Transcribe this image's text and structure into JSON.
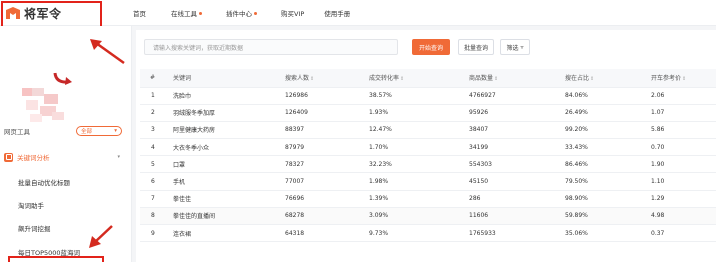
{
  "brand": {
    "name": "将军令"
  },
  "nav": [
    {
      "label": "首页",
      "dot": false,
      "caret": false
    },
    {
      "label": "在线工具",
      "dot": true,
      "caret": false
    },
    {
      "label": "插件中心",
      "dot": true,
      "caret": true
    },
    {
      "label": "购买VIP",
      "dot": false,
      "caret": false
    },
    {
      "label": "使用手册",
      "dot": false,
      "caret": false
    }
  ],
  "sidebar": {
    "tools_label": "网页工具",
    "filter_value": "全部",
    "section_label": "关键词分析",
    "sub_items": [
      "批量自动优化标题",
      "淘词助手",
      "飙升词挖掘",
      "每日TOP5000蓝海词"
    ]
  },
  "search": {
    "placeholder": "请输入搜索关键词，获取近期数据",
    "submit_label": "开始查询",
    "batch_label": "批量查询",
    "filter_label": "筛选"
  },
  "table": {
    "headers": [
      "#",
      "关键词",
      "搜索人数",
      "成交转化率",
      "商品数量",
      "搜在占比",
      "开车参考价"
    ],
    "sortable": [
      false,
      false,
      true,
      true,
      true,
      true,
      true
    ],
    "rows": [
      [
        "1",
        "洗脸巾",
        "126986",
        "38.57%",
        "4766927",
        "84.06%",
        "2.06"
      ],
      [
        "2",
        "羽绒服冬季加厚",
        "126409",
        "1.93%",
        "95926",
        "26.49%",
        "1.07"
      ],
      [
        "3",
        "阿里健康大药房",
        "88397",
        "12.47%",
        "38407",
        "99.20%",
        "5.86"
      ],
      [
        "4",
        "大衣冬季小众",
        "87979",
        "1.70%",
        "34199",
        "33.43%",
        "0.70"
      ],
      [
        "5",
        "口罩",
        "78327",
        "32.23%",
        "554303",
        "86.46%",
        "1.90"
      ],
      [
        "6",
        "手机",
        "77007",
        "1.98%",
        "45150",
        "79.50%",
        "1.10"
      ],
      [
        "7",
        "拳佳佳",
        "76696",
        "1.39%",
        "286",
        "98.90%",
        "1.29"
      ],
      [
        "8",
        "拳佳佳的直播间",
        "68278",
        "3.09%",
        "11606",
        "59.89%",
        "4.98"
      ],
      [
        "9",
        "连衣裙",
        "64318",
        "9.73%",
        "1765933",
        "35.06%",
        "0.37"
      ]
    ]
  },
  "colors": {
    "accent": "#f06a37",
    "annotation": "#e2231a"
  }
}
